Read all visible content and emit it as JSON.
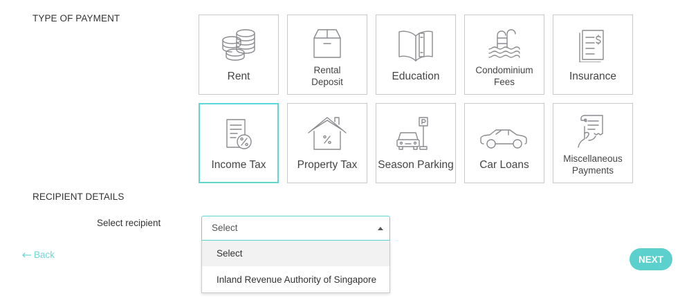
{
  "sections": {
    "type_of_payment": "TYPE OF PAYMENT",
    "recipient_details": "RECIPIENT DETAILS"
  },
  "payment_types": [
    {
      "label": "Rent",
      "icon": "coins-icon",
      "selected": false
    },
    {
      "label_line1": "Rental",
      "label_line2": "Deposit",
      "icon": "box-icon",
      "selected": false
    },
    {
      "label": "Education",
      "icon": "book-icon",
      "selected": false
    },
    {
      "label_line1": "Condominium",
      "label_line2": "Fees",
      "icon": "pool-icon",
      "selected": false
    },
    {
      "label": "Insurance",
      "icon": "dollar-document-icon",
      "selected": false
    },
    {
      "label": "Income Tax",
      "icon": "percent-document-icon",
      "selected": true
    },
    {
      "label": "Property Tax",
      "icon": "house-percent-icon",
      "selected": false
    },
    {
      "label": "Season Parking",
      "icon": "car-parking-icon",
      "selected": false
    },
    {
      "label": "Car Loans",
      "icon": "car-icon",
      "selected": false
    },
    {
      "label_line1": "Miscellaneous",
      "label_line2": "Payments",
      "icon": "receipt-hand-icon",
      "selected": false
    }
  ],
  "recipient": {
    "label": "Select recipient",
    "selected_value": "Select",
    "options": [
      "Select",
      "Inland Revenue Authority of Singapore"
    ]
  },
  "navigation": {
    "back_label": "Back",
    "next_label": "NEXT"
  },
  "colors": {
    "accent": "#5cd0cc",
    "selected_border": "#5cd6d6",
    "tile_border": "#c9c9c9",
    "icon_stroke": "#8a8a8f"
  }
}
